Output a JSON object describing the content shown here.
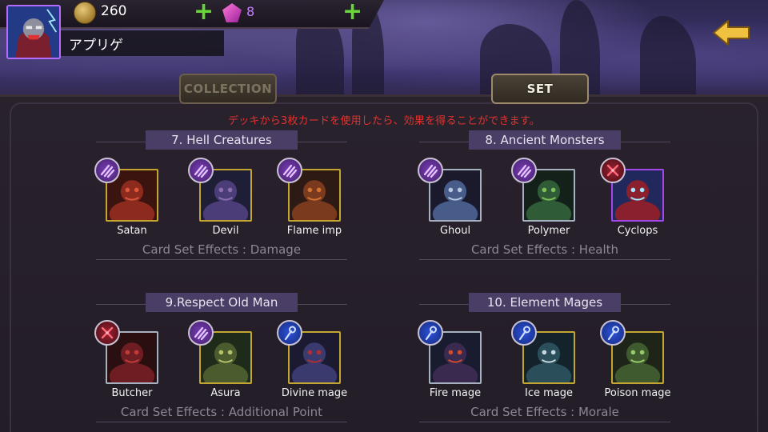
{
  "player": {
    "name": "アプリゲ",
    "gold": "260",
    "gems": "8"
  },
  "tabs": {
    "collection": "COLLECTION",
    "set": "SET"
  },
  "notice": "デッキから3枚カードを使用したら、効果を得ることができます。",
  "groups": [
    {
      "title": "7. Hell Creatures",
      "effect": "Card Set Effects : Damage",
      "cards": [
        {
          "name": "Satan",
          "badge": "claw-icon",
          "frame": "gold"
        },
        {
          "name": "Devil",
          "badge": "claw-icon",
          "frame": "gold"
        },
        {
          "name": "Flame imp",
          "badge": "claw-icon",
          "frame": "gold"
        }
      ]
    },
    {
      "title": "8. Ancient Monsters",
      "effect": "Card Set Effects : Health",
      "cards": [
        {
          "name": "Ghoul",
          "badge": "claw-icon",
          "frame": "silver"
        },
        {
          "name": "Polymer",
          "badge": "claw-icon",
          "frame": "silver"
        },
        {
          "name": "Cyclops",
          "badge": "sword-icon",
          "frame": "violet"
        }
      ]
    },
    {
      "title": "9.Respect Old Man",
      "effect": "Card Set Effects : Additional Point",
      "cards": [
        {
          "name": "Butcher",
          "badge": "sword-icon",
          "frame": "silver"
        },
        {
          "name": "Asura",
          "badge": "claw-icon",
          "frame": "gold"
        },
        {
          "name": "Divine mage",
          "badge": "staff-icon",
          "frame": "gold"
        }
      ]
    },
    {
      "title": "10. Element Mages",
      "effect": "Card Set Effects : Morale",
      "cards": [
        {
          "name": "Fire mage",
          "badge": "staff-icon",
          "frame": "silver"
        },
        {
          "name": "Ice mage",
          "badge": "staff-icon",
          "frame": "gold"
        },
        {
          "name": "Poison mage",
          "badge": "staff-icon",
          "frame": "gold"
        }
      ]
    }
  ],
  "colors": {
    "accent": "#4a3d66",
    "notice": "#e5312c",
    "plus": "#68d63a",
    "gem": "#c77dff"
  }
}
